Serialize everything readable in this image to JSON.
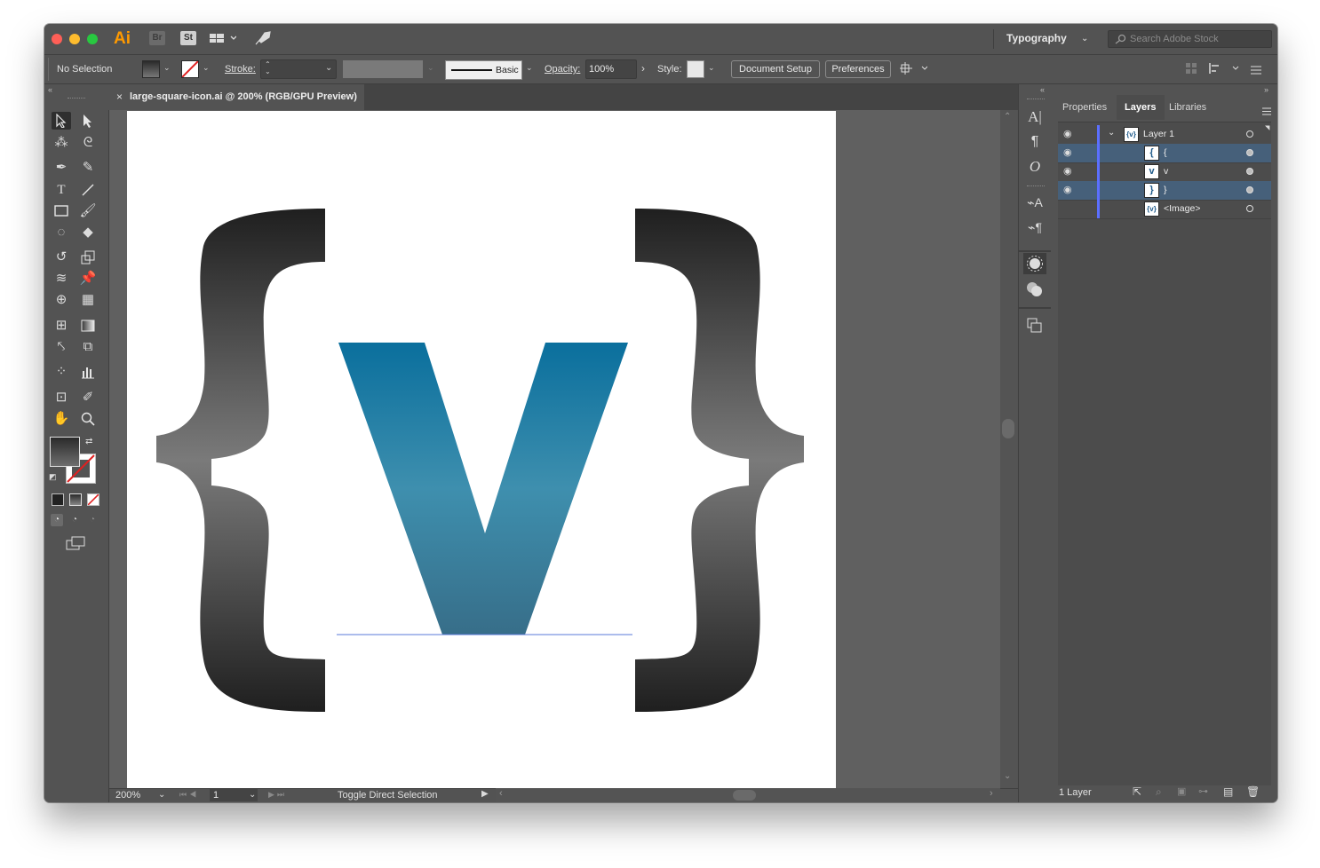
{
  "app": {
    "logo": "Ai",
    "bridge": "Br",
    "stock": "St"
  },
  "workspace": {
    "label": "Typography"
  },
  "search": {
    "placeholder": "Search Adobe Stock"
  },
  "controlbar": {
    "selection": "No Selection",
    "stroke_label": "Stroke:",
    "brush_label": "Basic",
    "opacity_label": "Opacity:",
    "opacity_value": "100%",
    "style_label": "Style:",
    "document_setup": "Document Setup",
    "preferences": "Preferences"
  },
  "document": {
    "tab_title": "large-square-icon.ai @ 200% (RGB/GPU Preview)"
  },
  "statusbar": {
    "zoom": "200%",
    "artboard": "1",
    "status": "Toggle Direct Selection"
  },
  "panel": {
    "tabs": [
      "Properties",
      "Layers",
      "Libraries"
    ],
    "active_tab": "Layers",
    "layers": [
      {
        "name": "Layer 1",
        "thumb": "{v}",
        "selected": false
      },
      {
        "name": "{",
        "thumb": "{",
        "selected": true
      },
      {
        "name": "v",
        "thumb": "v",
        "selected": false
      },
      {
        "name": "}",
        "thumb": "}",
        "selected": true
      },
      {
        "name": "<Image>",
        "thumb": "{v}",
        "selected": false
      }
    ],
    "footer": "1 Layer"
  },
  "colors": {
    "accent_blue": "#0a6f9d",
    "panel_bg": "#535353",
    "selection_row": "#46607a",
    "layer_color": "#5b6fff"
  }
}
